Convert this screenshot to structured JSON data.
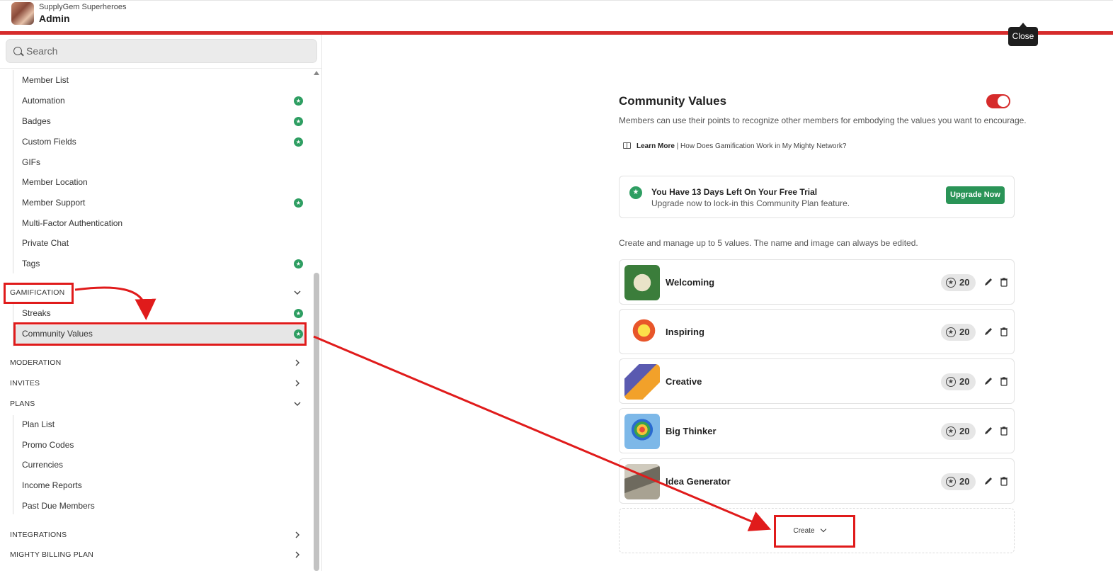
{
  "header": {
    "org_name": "SupplyGem Superheroes",
    "role": "Admin",
    "close_tooltip": "Close"
  },
  "sidebar": {
    "search_placeholder": "Search",
    "items_top": [
      {
        "label": "Member List",
        "badge": false
      },
      {
        "label": "Automation",
        "badge": true
      },
      {
        "label": "Badges",
        "badge": true
      },
      {
        "label": "Custom Fields",
        "badge": true
      },
      {
        "label": "GIFs",
        "badge": false
      },
      {
        "label": "Member Location",
        "badge": false
      },
      {
        "label": "Member Support",
        "badge": true
      },
      {
        "label": "Multi-Factor Authentication",
        "badge": false
      },
      {
        "label": "Private Chat",
        "badge": false
      },
      {
        "label": "Tags",
        "badge": true
      }
    ],
    "gamification": {
      "label": "GAMIFICATION",
      "items": [
        {
          "label": "Streaks",
          "badge": true
        },
        {
          "label": "Community Values",
          "badge": true,
          "active": true
        }
      ]
    },
    "moderation": "MODERATION",
    "invites": "INVITES",
    "plans": {
      "label": "PLANS",
      "items": [
        "Plan List",
        "Promo Codes",
        "Currencies",
        "Income Reports",
        "Past Due Members"
      ]
    },
    "integrations": "INTEGRATIONS",
    "billing": "MIGHTY BILLING PLAN"
  },
  "main": {
    "title": "Community Values",
    "subtitle": "Members can use their points to recognize other members for embodying the values you want to encourage.",
    "learn_more_bold": "Learn More",
    "learn_more_rest": " | How Does Gamification Work in My Mighty Network?",
    "trial": {
      "title": "You Have 13 Days Left On Your Free Trial",
      "subtitle": "Upgrade now to lock-in this Community Plan feature.",
      "button": "Upgrade Now"
    },
    "manage_text": "Create and manage up to 5 values. The name and image can always be edited.",
    "values": [
      {
        "name": "Welcoming",
        "points": "20"
      },
      {
        "name": "Inspiring",
        "points": "20"
      },
      {
        "name": "Creative",
        "points": "20"
      },
      {
        "name": "Big Thinker",
        "points": "20"
      },
      {
        "name": "Idea Generator",
        "points": "20"
      }
    ],
    "create_label": "Create"
  },
  "colors": {
    "accent_red": "#d62b2b",
    "badge_green": "#2e9e62",
    "upgrade_green": "#2a9457",
    "annotation_red": "#e01b1b"
  }
}
